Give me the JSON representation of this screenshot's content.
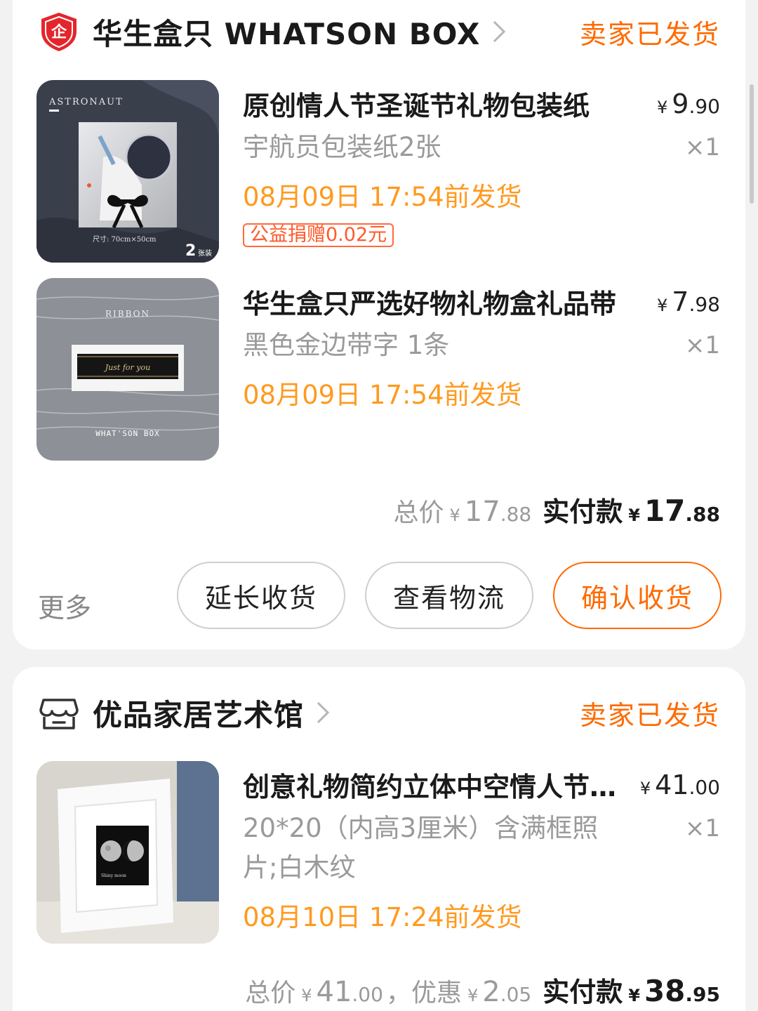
{
  "orders": [
    {
      "shop_name": "华生盒只 WHATSON BOX",
      "status": "卖家已发货",
      "items": [
        {
          "title": "原创情人节圣诞节礼物包装纸",
          "price_int": "9",
          "price_dec": ".90",
          "spec": "宇航员包装纸2张",
          "qty": "×1",
          "ship": "08月09日 17:54前发货",
          "tag": "公益捐赠0.02元",
          "thumb_text": [
            "ASTRONAUT",
            "尺寸: 70cm×50cm",
            "2",
            "张装"
          ]
        },
        {
          "title": "华生盒只严选好物礼物盒礼品带",
          "price_int": "7",
          "price_dec": ".98",
          "spec": "黑色金边带字 1条",
          "qty": "×1",
          "ship": "08月09日 17:54前发货",
          "thumb_text": [
            "RIBBON",
            "Just for you",
            "WHAT'SON BOX"
          ]
        }
      ],
      "summary": {
        "total_label": "总价",
        "total_int": "17",
        "total_dec": ".88",
        "paid_label": "实付款",
        "paid_int": "17",
        "paid_dec": ".88"
      },
      "actions": {
        "more": "更多",
        "extend": "延长收货",
        "logistics": "查看物流",
        "confirm": "确认收货"
      }
    },
    {
      "shop_name": "优品家居艺术馆",
      "status": "卖家已发货",
      "items": [
        {
          "title": "创意礼物简约立体中空情人节相框",
          "price_int": "41",
          "price_dec": ".00",
          "spec": "20*20（内高3厘米）含满框照片;白木纹",
          "qty": "×1",
          "ship": "08月10日 17:24前发货",
          "thumb_text": [
            "Shiny moon"
          ]
        }
      ],
      "summary": {
        "total_label": "总价",
        "total_int": "41",
        "total_dec": ".00",
        "discount_label": "，优惠",
        "discount_int": "2",
        "discount_dec": ".05",
        "paid_label": "实付款",
        "paid_int": "38",
        "paid_dec": ".95"
      }
    }
  ],
  "currency_symbol": "¥",
  "colors": {
    "accent": "#ff6a00",
    "ship_text": "#ff9a1f",
    "background": "#f2f2f2"
  },
  "icons": {
    "shop1": "enterprise-shield-icon",
    "shop2": "storefront-icon",
    "chevron": "chevron-right-icon"
  }
}
